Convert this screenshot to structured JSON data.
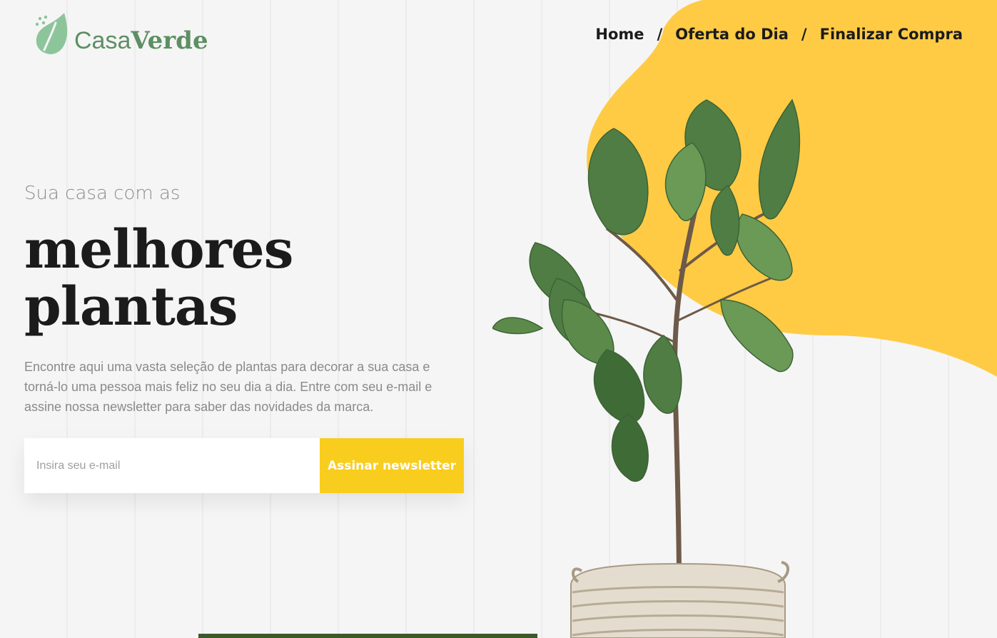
{
  "brand": {
    "name_part1": "Casa",
    "name_part2": "Verde",
    "icon": "leaf-icon",
    "color": "#5d8f63"
  },
  "nav": {
    "items": [
      {
        "label": "Home"
      },
      {
        "label": "Oferta do Dia"
      },
      {
        "label": "Finalizar Compra"
      }
    ],
    "separator": "/"
  },
  "hero": {
    "eyebrow": "Sua casa com as",
    "title_line1": "melhores",
    "title_line2": "plantas",
    "description": "Encontre aqui uma vasta seleção de plantas para decorar a sua casa e torná-lo uma pessoa mais feliz no seu dia a dia. Entre com seu e-mail e assine nossa newsletter para saber das novidades da marca."
  },
  "newsletter": {
    "email_placeholder": "Insira seu e-mail",
    "email_value": "",
    "button_label": "Assinar newsletter"
  },
  "colors": {
    "accent": "#f9cd1e",
    "blob": "#ffcb45",
    "text": "#1b1b1b",
    "muted": "#8a8a8a"
  }
}
